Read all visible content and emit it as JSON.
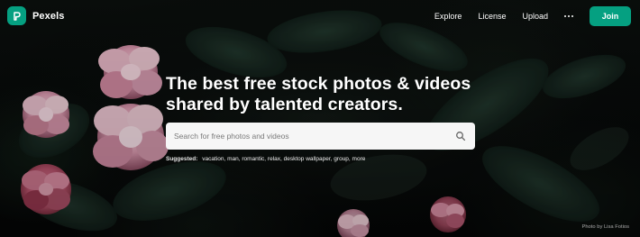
{
  "colors": {
    "brand": "#05a081",
    "overlay": "#000000",
    "search_background": "#f6f6f6"
  },
  "brand": {
    "name": "Pexels",
    "logo_icon": "pexels-logo-icon"
  },
  "nav": {
    "items": [
      "Explore",
      "License",
      "Upload"
    ],
    "more_icon": "more-dots-icon",
    "join_label": "Join"
  },
  "hero": {
    "headline": "The best free stock photos & videos\nshared by talented creators.",
    "search": {
      "placeholder": "Search for free photos and videos",
      "value": "",
      "icon": "search-icon"
    },
    "suggested": {
      "label": "Suggested:",
      "items": [
        "vacation",
        "man",
        "romantic",
        "relax",
        "desktop wallpaper",
        "group",
        "more"
      ]
    },
    "photo_credit": "Photo by Lisa Fotios"
  }
}
